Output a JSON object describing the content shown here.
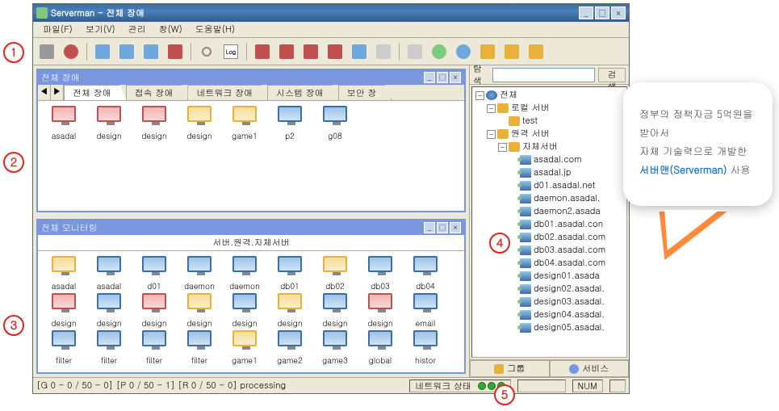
{
  "window": {
    "title": "Serverman - 전체 장애"
  },
  "menubar": [
    "파일(F)",
    "보기(V)",
    "관리",
    "창(W)",
    "도움말(H)"
  ],
  "toolbar_icons": [
    "back",
    "power",
    "app1",
    "monitor-single",
    "monitor-multi",
    "disk",
    "search",
    "log",
    "alert-red",
    "alert-box",
    "alert-bell",
    "page-red",
    "page-blue",
    "page-plain",
    "page-stack",
    "gear-green",
    "gear-blue",
    "page-yellow",
    "folder",
    "help"
  ],
  "panel_fault": {
    "title": "전체 장애",
    "tabs": [
      "전체 장애",
      "접속 장애",
      "네트워크 장애",
      "시스템 장애",
      "보안 장"
    ],
    "active_tab": 0,
    "items": [
      {
        "label": "asadal",
        "color": "red"
      },
      {
        "label": "design",
        "color": "red"
      },
      {
        "label": "design",
        "color": "red"
      },
      {
        "label": "design",
        "color": "yellow"
      },
      {
        "label": "game1",
        "color": "yellow"
      },
      {
        "label": "p2",
        "color": "blue"
      },
      {
        "label": "g08",
        "color": "blue"
      }
    ]
  },
  "panel_monitor": {
    "title": "전체 모니터링",
    "path": "서버.원격.자체서버",
    "items": [
      {
        "label": "asadal",
        "color": "yellow"
      },
      {
        "label": "asadal",
        "color": "blue"
      },
      {
        "label": "d01",
        "color": "blue"
      },
      {
        "label": "daemon",
        "color": "blue"
      },
      {
        "label": "daemon",
        "color": "blue"
      },
      {
        "label": "db01",
        "color": "blue"
      },
      {
        "label": "db02",
        "color": "yellow"
      },
      {
        "label": "db03",
        "color": "blue"
      },
      {
        "label": "db04",
        "color": "blue"
      },
      {
        "label": "design",
        "color": "red"
      },
      {
        "label": "design",
        "color": "blue"
      },
      {
        "label": "design",
        "color": "red"
      },
      {
        "label": "design",
        "color": "yellow"
      },
      {
        "label": "design",
        "color": "blue"
      },
      {
        "label": "design",
        "color": "yellow"
      },
      {
        "label": "design",
        "color": "blue"
      },
      {
        "label": "design",
        "color": "red"
      },
      {
        "label": "email",
        "color": "blue"
      },
      {
        "label": "filter",
        "color": "blue"
      },
      {
        "label": "filter",
        "color": "blue"
      },
      {
        "label": "filter",
        "color": "blue"
      },
      {
        "label": "filter",
        "color": "blue"
      },
      {
        "label": "game1",
        "color": "yellow"
      },
      {
        "label": "game2",
        "color": "blue"
      },
      {
        "label": "game3",
        "color": "blue"
      },
      {
        "label": "global",
        "color": "blue"
      },
      {
        "label": "histor",
        "color": "blue"
      }
    ]
  },
  "search_panel": {
    "label": "탐색",
    "button": "검색"
  },
  "tree": [
    {
      "ind": 0,
      "exp": "-",
      "icon": "globe",
      "label": "전체"
    },
    {
      "ind": 1,
      "exp": "-",
      "icon": "group",
      "label": "로컬 서버"
    },
    {
      "ind": 2,
      "exp": " ",
      "icon": "group",
      "label": "test"
    },
    {
      "ind": 1,
      "exp": "-",
      "icon": "group",
      "label": "원격 서버"
    },
    {
      "ind": 2,
      "exp": "-",
      "icon": "group",
      "label": "자체서버"
    },
    {
      "ind": 3,
      "exp": " ",
      "icon": "srv",
      "label": "asadal.com"
    },
    {
      "ind": 3,
      "exp": " ",
      "icon": "srv",
      "label": "asadal.jp"
    },
    {
      "ind": 3,
      "exp": " ",
      "icon": "srv",
      "label": "d01.asadal.net"
    },
    {
      "ind": 3,
      "exp": " ",
      "icon": "srv",
      "label": "daemon.asadal."
    },
    {
      "ind": 3,
      "exp": " ",
      "icon": "srv",
      "label": "daemon2.asada"
    },
    {
      "ind": 3,
      "exp": " ",
      "icon": "srv",
      "label": "db01.asadal.con"
    },
    {
      "ind": 3,
      "exp": " ",
      "icon": "srv",
      "label": "db02.asadal.com"
    },
    {
      "ind": 3,
      "exp": " ",
      "icon": "srv",
      "label": "db03.asadal.com"
    },
    {
      "ind": 3,
      "exp": " ",
      "icon": "srv",
      "label": "db04.asadal.com"
    },
    {
      "ind": 3,
      "exp": " ",
      "icon": "srv",
      "label": "design01.asada"
    },
    {
      "ind": 3,
      "exp": " ",
      "icon": "srv",
      "label": "design02.asadal."
    },
    {
      "ind": 3,
      "exp": " ",
      "icon": "srv",
      "label": "design03.asadal."
    },
    {
      "ind": 3,
      "exp": " ",
      "icon": "srv",
      "label": "design04.asadal."
    },
    {
      "ind": 3,
      "exp": " ",
      "icon": "srv",
      "label": "design05.asadal."
    }
  ],
  "bottom_tabs": {
    "group": "그룹",
    "service": "서비스"
  },
  "statusbar": {
    "left": "[G  0 - 0 / 50 - 0] [P 0 / 50 - 1] [R 0 / 50 - 0] processing",
    "net_label": "네트워크 상태",
    "num": "NUM"
  },
  "callout": {
    "line1": "정부의 정책자금 5억원을 받아서",
    "line2": "자체 기술력으로 개발한",
    "brand": "서버맨(Serverman)",
    "suffix": " 사용"
  },
  "badges": [
    "1",
    "2",
    "3",
    "4",
    "5"
  ]
}
